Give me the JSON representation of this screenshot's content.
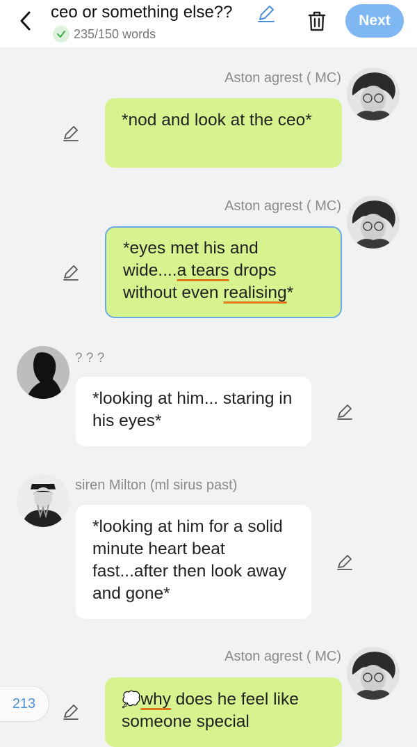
{
  "header": {
    "title": "ceo or something else??",
    "word_count": "235/150 words",
    "next_label": "Next"
  },
  "colors": {
    "mine_bubble": "#d7f38f",
    "other_bubble": "#ffffff",
    "accent": "#7fb7f2",
    "selected_border": "#6aa9e6",
    "underline": "#e0761b"
  },
  "messages": [
    {
      "speaker": "Aston agrest ( MC)",
      "side": "right",
      "text": "*nod and look at the ceo*"
    },
    {
      "speaker": "Aston agrest ( MC)",
      "side": "right",
      "selected": true,
      "text_parts": [
        "*eyes met his and wide....",
        "a  tears",
        " drops without even ",
        "realising",
        "*"
      ]
    },
    {
      "speaker": "? ? ?",
      "side": "left",
      "text": "*looking at him... staring in his eyes*"
    },
    {
      "speaker": "siren Milton (ml sirus past)",
      "side": "left",
      "text": "*looking at him for a solid minute heart beat fast...after then look away and gone*"
    },
    {
      "speaker": "Aston agrest ( MC)",
      "side": "right",
      "text_parts": [
        "💭",
        "why",
        " does he feel like someone special"
      ]
    }
  ],
  "side_counter": "213",
  "icons": {
    "back": "chevron-left-icon",
    "title_edit": "pencil-icon",
    "verified": "check-icon",
    "delete": "trash-icon",
    "edit": "pencil-icon",
    "thought": "thought-bubble-icon"
  }
}
